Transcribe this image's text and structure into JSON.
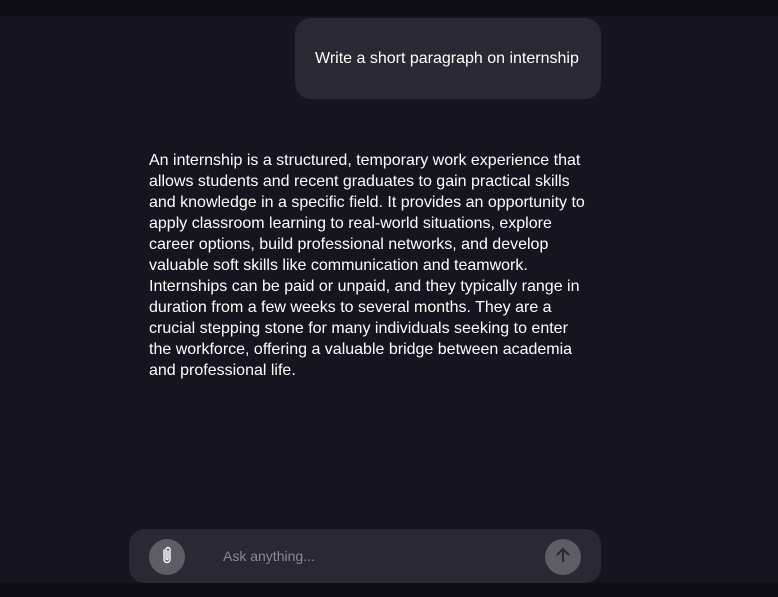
{
  "conversation": {
    "user_message": "Write a short paragraph on internship",
    "assistant_message": "An internship is a structured, temporary work experience that allows students and recent graduates to gain practical skills and knowledge in a specific field. It provides an opportunity to apply classroom learning to real-world situations, explore career options, build professional networks, and develop valuable soft skills like communication and teamwork. Internships can be paid or unpaid, and they typically range in duration from a few weeks to several months. They are a crucial stepping stone for many individuals seeking to enter the workforce, offering a valuable bridge between academia and professional life."
  },
  "composer": {
    "placeholder": "Ask anything...",
    "value": "",
    "attach_icon": "paperclip-icon",
    "send_icon": "arrow-up-icon"
  },
  "colors": {
    "background": "#16141f",
    "bubble": "#2a2833",
    "button": "#5e5c65",
    "text": "#ffffff",
    "placeholder": "#8b8992"
  }
}
